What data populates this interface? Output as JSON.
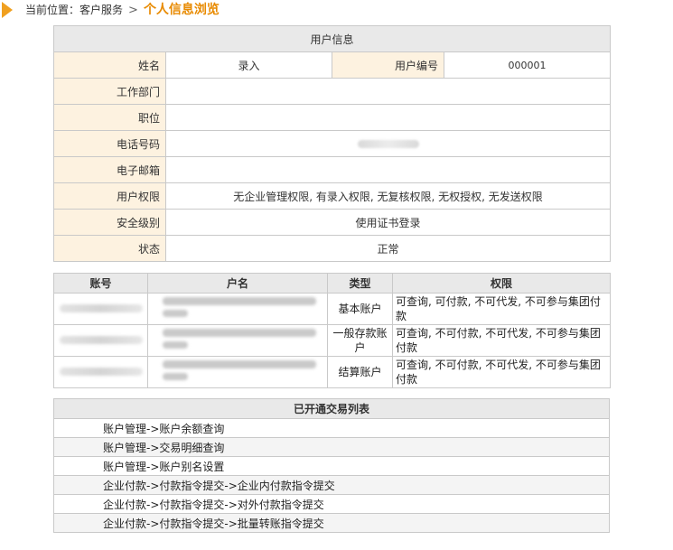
{
  "breadcrumb": {
    "prefix": "当前位置：",
    "parent": "客户服务",
    "separator": ">",
    "current": "个人信息浏览"
  },
  "user_info": {
    "title": "用户信息",
    "name_label": "姓名",
    "name_value": "录入",
    "user_no_label": "用户编号",
    "user_no_value": "000001",
    "dept_label": "工作部门",
    "dept_value": "",
    "position_label": "职位",
    "position_value": "",
    "phone_label": "电话号码",
    "email_label": "电子邮箱",
    "email_value": "",
    "perm_label": "用户权限",
    "perm_value": "无企业管理权限, 有录入权限, 无复核权限, 无权授权, 无发送权限",
    "security_label": "安全级别",
    "security_value": "使用证书登录",
    "status_label": "状态",
    "status_value": "正常"
  },
  "accounts": {
    "headers": [
      "账号",
      "户名",
      "类型",
      "权限"
    ],
    "rows": [
      {
        "type": "基本账户",
        "perm": "可查询, 可付款, 不可代发, 不可参与集团付款"
      },
      {
        "type": "一般存款账户",
        "perm": "可查询, 不可付款, 不可代发, 不可参与集团付款"
      },
      {
        "type": "结算账户",
        "perm": "可查询, 不可付款, 不可代发, 不可参与集团付款"
      }
    ]
  },
  "trades": {
    "title": "已开通交易列表",
    "items": [
      "账户管理->账户余额查询",
      "账户管理->交易明细查询",
      "账户管理->账户别名设置",
      "企业付款->付款指令提交->企业内付款指令提交",
      "企业付款->付款指令提交->对外付款指令提交",
      "企业付款->付款指令提交->批量转账指令提交"
    ]
  }
}
